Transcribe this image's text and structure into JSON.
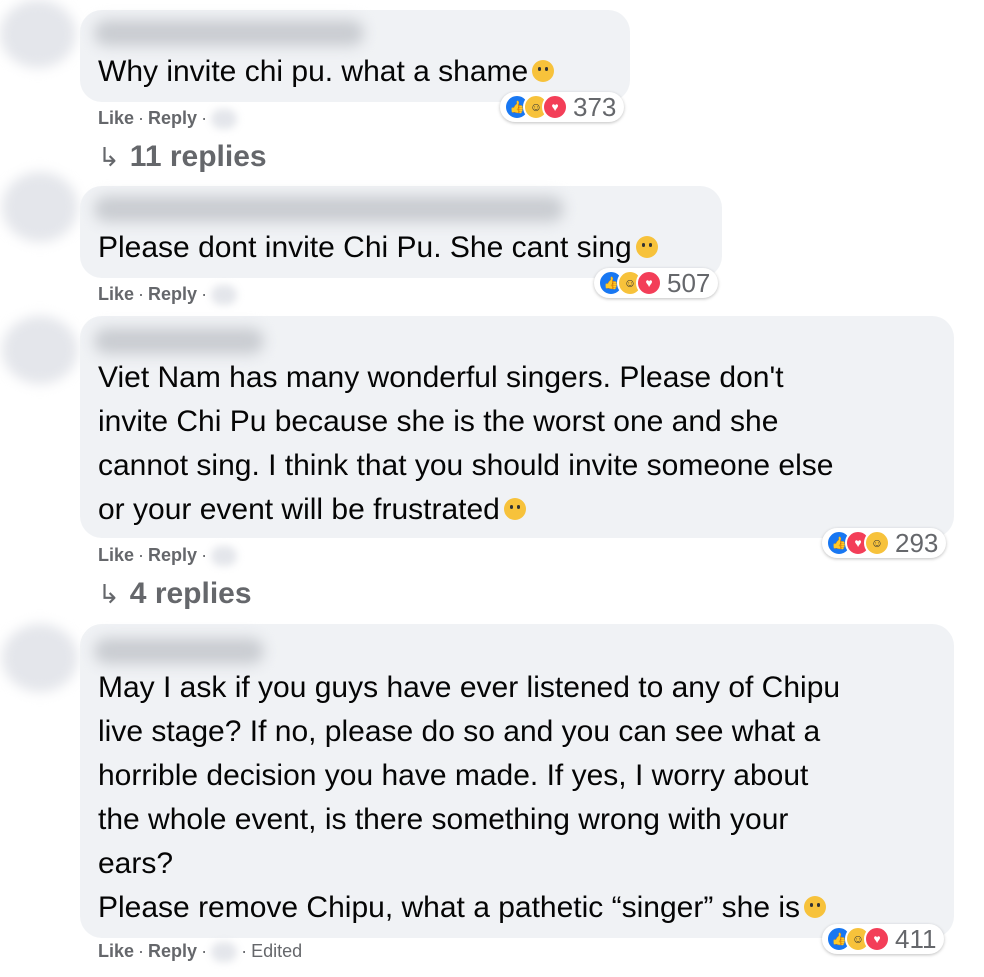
{
  "comments": [
    {
      "text_lines": [
        "Why invite chi pu. what a shame"
      ],
      "emoji": "sad-face-icon",
      "reaction_count": "373",
      "actions": {
        "like": "Like",
        "reply": "Reply"
      },
      "replies_label": "11 replies"
    },
    {
      "text_lines": [
        "Please dont invite Chi Pu. She cant sing"
      ],
      "emoji": "tired-face-icon",
      "reaction_count": "507",
      "actions": {
        "like": "Like",
        "reply": "Reply"
      }
    },
    {
      "text_lines": [
        "Viet Nam has many wonderful singers. Please don't",
        "invite Chi Pu because she is the worst one and she",
        "cannot sing. I think that you should invite someone else",
        "or your event will be frustrated"
      ],
      "emoji": "disappointed-face-icon",
      "reaction_count": "293",
      "actions": {
        "like": "Like",
        "reply": "Reply"
      },
      "replies_label": "4 replies"
    },
    {
      "text_lines": [
        "May I ask if you guys have ever listened to any of Chipu",
        "live stage? If no, please do so and you can see what a",
        "horrible decision you have made. If yes, I worry about",
        "the whole event, is there something wrong with your",
        "ears?",
        "Please remove Chipu, what a pathetic “singer” she is"
      ],
      "emoji": "slight-smile-icon",
      "reaction_count": "411",
      "actions": {
        "like": "Like",
        "reply": "Reply",
        "edited": "Edited"
      }
    }
  ],
  "colors": {
    "bubble": "#f0f2f5",
    "meta": "#65676b",
    "like_blue": "#1877f2",
    "love_red": "#f33e58",
    "haha_yellow": "#f7c23b"
  }
}
